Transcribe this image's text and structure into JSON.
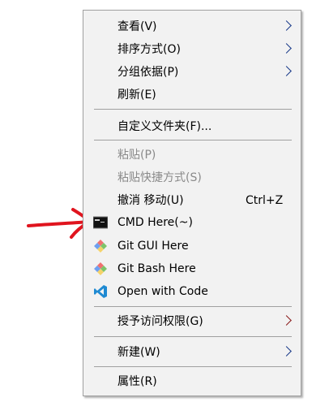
{
  "menu": {
    "items": [
      {
        "label": "查看(V)",
        "submenu": true
      },
      {
        "label": "排序方式(O)",
        "submenu": true
      },
      {
        "label": "分组依据(P)",
        "submenu": true
      },
      {
        "label": "刷新(E)"
      },
      {
        "label": "自定义文件夹(F)..."
      },
      {
        "label": "粘贴(P)",
        "disabled": true
      },
      {
        "label": "粘贴快捷方式(S)",
        "disabled": true
      },
      {
        "label": "撤消 移动(U)",
        "shortcut": "Ctrl+Z"
      },
      {
        "label": "CMD Here(~)",
        "icon": "cmd-icon"
      },
      {
        "label": "Git GUI Here",
        "icon": "git-icon"
      },
      {
        "label": "Git Bash Here",
        "icon": "git-icon"
      },
      {
        "label": "Open with Code",
        "icon": "vscode-icon"
      },
      {
        "label": "授予访问权限(G)",
        "submenu": true
      },
      {
        "label": "新建(W)",
        "submenu": true
      },
      {
        "label": "属性(R)"
      }
    ]
  },
  "colors": {
    "menu_bg": "#f2f2f2",
    "annotation": "#e0141e",
    "disabled": "#8a8a8a"
  }
}
